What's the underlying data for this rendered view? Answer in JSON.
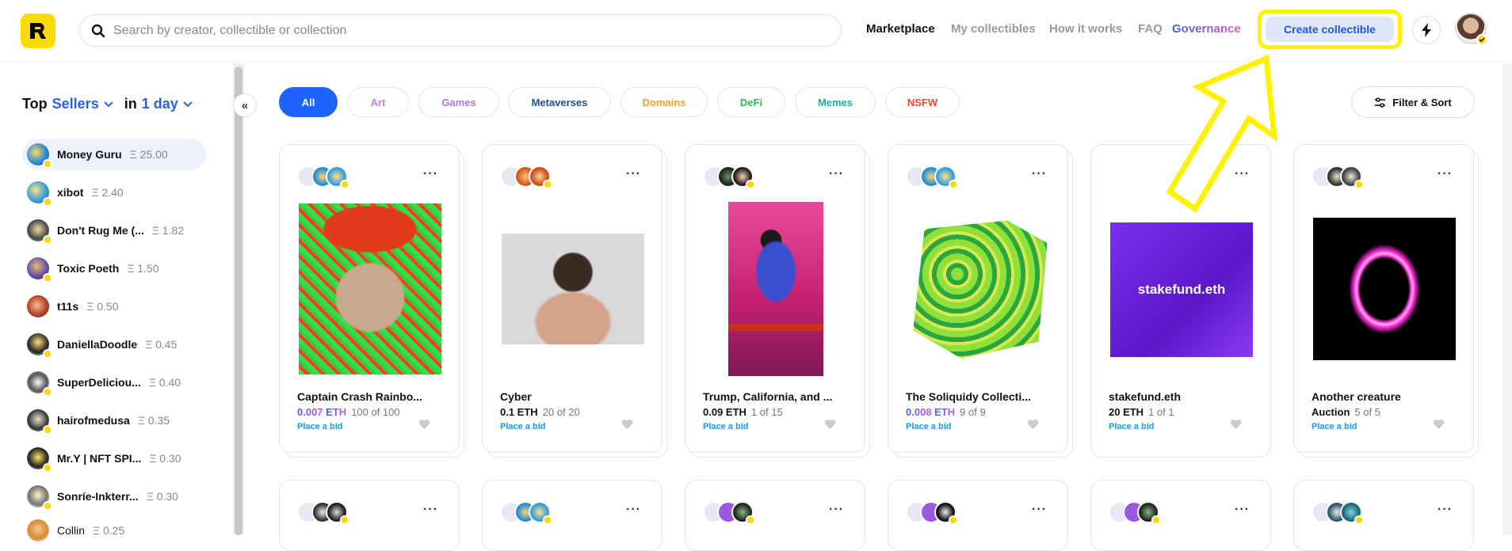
{
  "header": {
    "search_placeholder": "Search by creator, collectible or collection",
    "nav": [
      "Marketplace",
      "My collectibles",
      "How it works",
      "FAQ",
      "Governance"
    ],
    "create_label": "Create collectible"
  },
  "sidebar": {
    "top_label": "Top",
    "sellers_label": "Sellers",
    "in_label": "in",
    "period_label": "1 day",
    "sellers": [
      {
        "name": "Money Guru",
        "amount": "Ξ 25.00"
      },
      {
        "name": "xibot",
        "amount": "Ξ 2.40"
      },
      {
        "name": "Don't Rug Me (...",
        "amount": "Ξ 1.82"
      },
      {
        "name": "Toxic Poeth",
        "amount": "Ξ 1.50"
      },
      {
        "name": "t11s",
        "amount": "Ξ 0.50"
      },
      {
        "name": "DaniellaDoodle",
        "amount": "Ξ 0.45"
      },
      {
        "name": "SuperDeliciou...",
        "amount": "Ξ 0.40"
      },
      {
        "name": "hairofmedusa",
        "amount": "Ξ 0.35"
      },
      {
        "name": "Mr.Y | NFT SPI...",
        "amount": "Ξ 0.30"
      },
      {
        "name": "Sonríe-Inkterr...",
        "amount": "Ξ 0.30"
      },
      {
        "name": "Collin",
        "amount": "Ξ 0.25"
      }
    ]
  },
  "filters": {
    "chips": [
      "All",
      "Art",
      "Games",
      "Metaverses",
      "Domains",
      "DeFi",
      "Memes",
      "NSFW"
    ],
    "filter_sort_label": "Filter & Sort"
  },
  "cards": [
    {
      "title": "Captain Crash Rainbo...",
      "price": "0.007",
      "currency": " ETH",
      "gradient": true,
      "count": "100 of 100",
      "action": "Place a bid"
    },
    {
      "title": "Cyber",
      "price": "0.1 ETH",
      "currency": "",
      "gradient": false,
      "count": "20 of 20",
      "action": "Place a bid"
    },
    {
      "title": "Trump, California, and ...",
      "price": "0.09 ETH",
      "currency": "",
      "gradient": false,
      "count": "1 of 15",
      "action": "Place a bid"
    },
    {
      "title": "The Soliquidy Collecti...",
      "price": "0.008",
      "currency": " ETH",
      "gradient": true,
      "count": "9 of 9",
      "action": "Place a bid"
    },
    {
      "title": "stakefund.eth",
      "price": "20 ETH",
      "currency": "",
      "gradient": false,
      "count": "1 of 1",
      "action": "Place a bid",
      "image_text": "stakefund.eth"
    },
    {
      "title": "Another creature",
      "price": "Auction",
      "currency": "",
      "gradient": false,
      "count": "5 of 5",
      "action": "Place a bid"
    }
  ],
  "more_label": "···"
}
